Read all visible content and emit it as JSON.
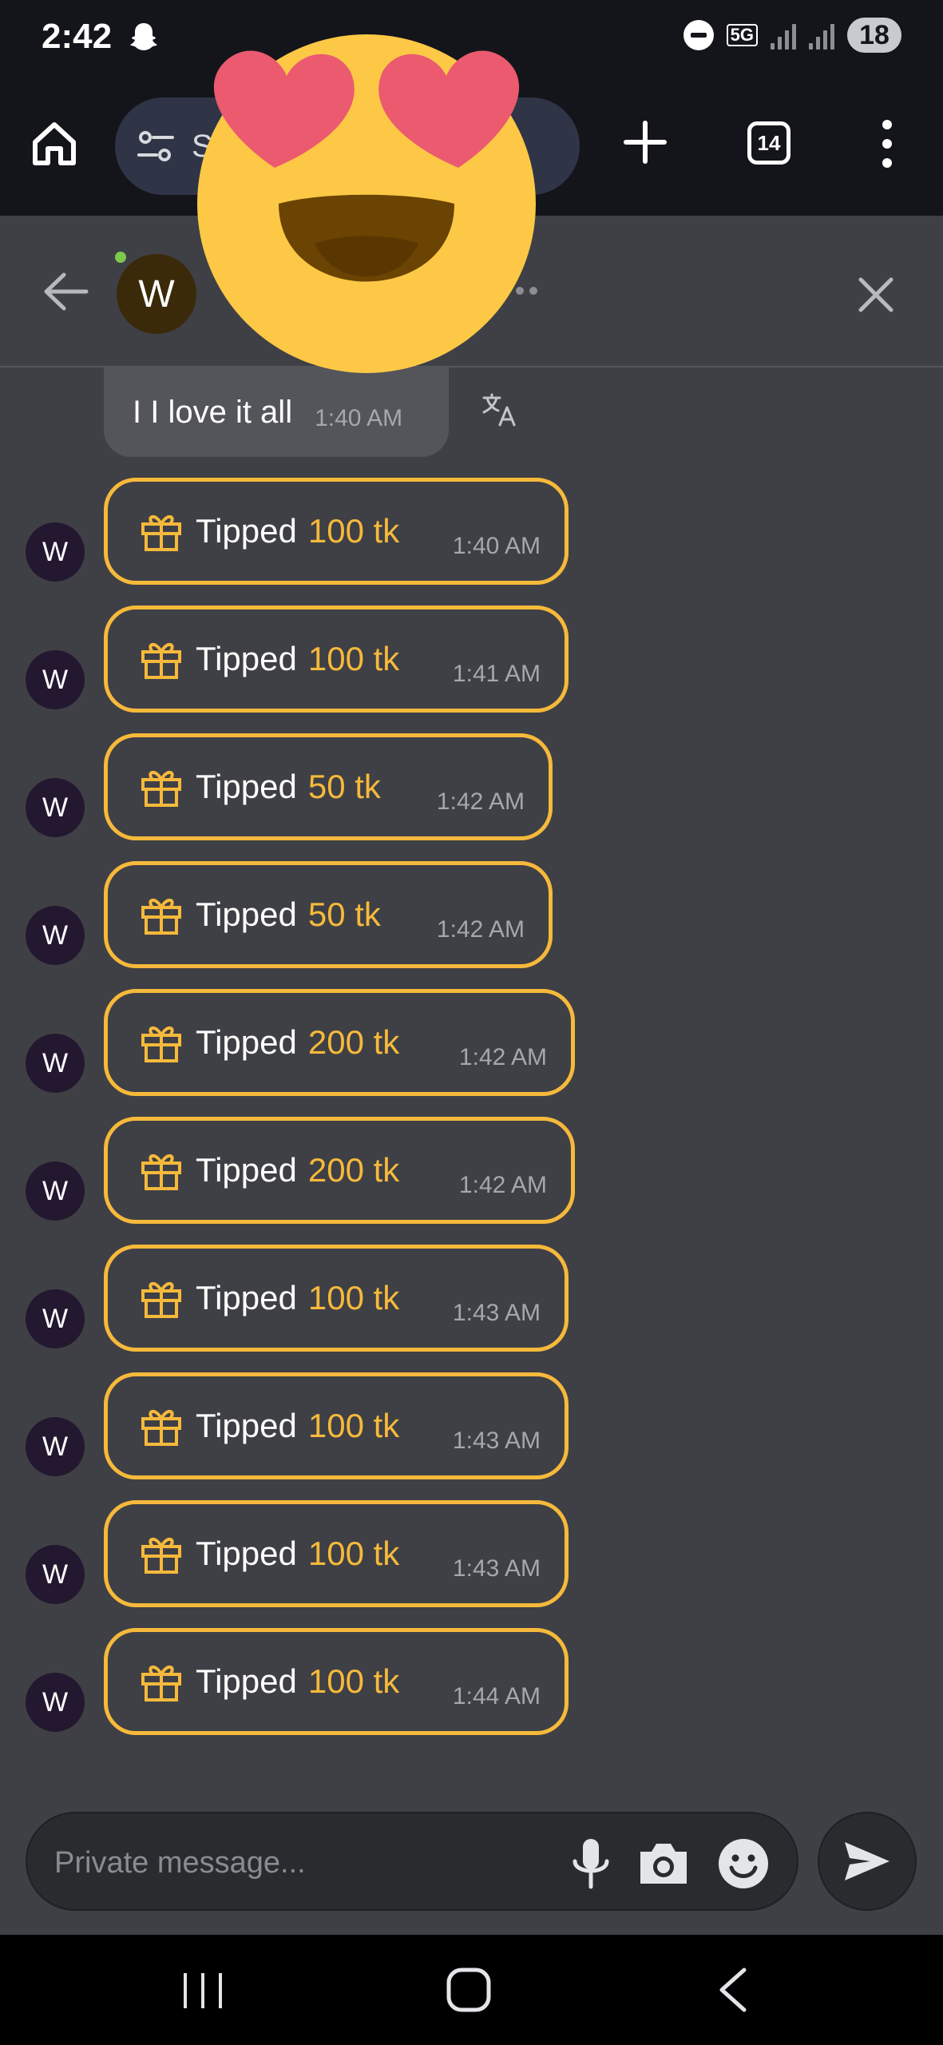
{
  "status_bar": {
    "time": "2:42",
    "network": "5G",
    "battery": "18"
  },
  "browser": {
    "url_text": "S",
    "tabs_count": "14"
  },
  "chat_header": {
    "avatar_letter": "W"
  },
  "messages": {
    "plain": {
      "text": "I I love it all",
      "time": "1:40 AM"
    },
    "tips": [
      {
        "avatar": "W",
        "label": "Tipped",
        "amount": "100 tk",
        "time": "1:40 AM"
      },
      {
        "avatar": "W",
        "label": "Tipped",
        "amount": "100 tk",
        "time": "1:41 AM"
      },
      {
        "avatar": "W",
        "label": "Tipped",
        "amount": "50 tk",
        "time": "1:42 AM"
      },
      {
        "avatar": "W",
        "label": "Tipped",
        "amount": "50 tk",
        "time": "1:42 AM"
      },
      {
        "avatar": "W",
        "label": "Tipped",
        "amount": "200 tk",
        "time": "1:42 AM"
      },
      {
        "avatar": "W",
        "label": "Tipped",
        "amount": "200 tk",
        "time": "1:42 AM"
      },
      {
        "avatar": "W",
        "label": "Tipped",
        "amount": "100 tk",
        "time": "1:43 AM"
      },
      {
        "avatar": "W",
        "label": "Tipped",
        "amount": "100 tk",
        "time": "1:43 AM"
      },
      {
        "avatar": "W",
        "label": "Tipped",
        "amount": "100 tk",
        "time": "1:43 AM"
      },
      {
        "avatar": "W",
        "label": "Tipped",
        "amount": "100 tk",
        "time": "1:44 AM"
      }
    ]
  },
  "composer": {
    "placeholder": "Private message..."
  },
  "colors": {
    "background": "#3f4045",
    "tip_accent": "#f6b93b",
    "browser_bar": "#14151a"
  },
  "icons": [
    "snapchat-ghost-icon",
    "do-not-disturb-icon",
    "home-icon",
    "tune-icon",
    "plus-icon",
    "tabs-icon",
    "more-vert-icon",
    "back-arrow-icon",
    "close-icon",
    "heart-eyes-emoji",
    "translate-icon",
    "gift-icon",
    "mic-icon",
    "camera-icon",
    "emoji-icon",
    "send-icon",
    "recents-icon",
    "home-nav-icon",
    "back-nav-icon"
  ]
}
